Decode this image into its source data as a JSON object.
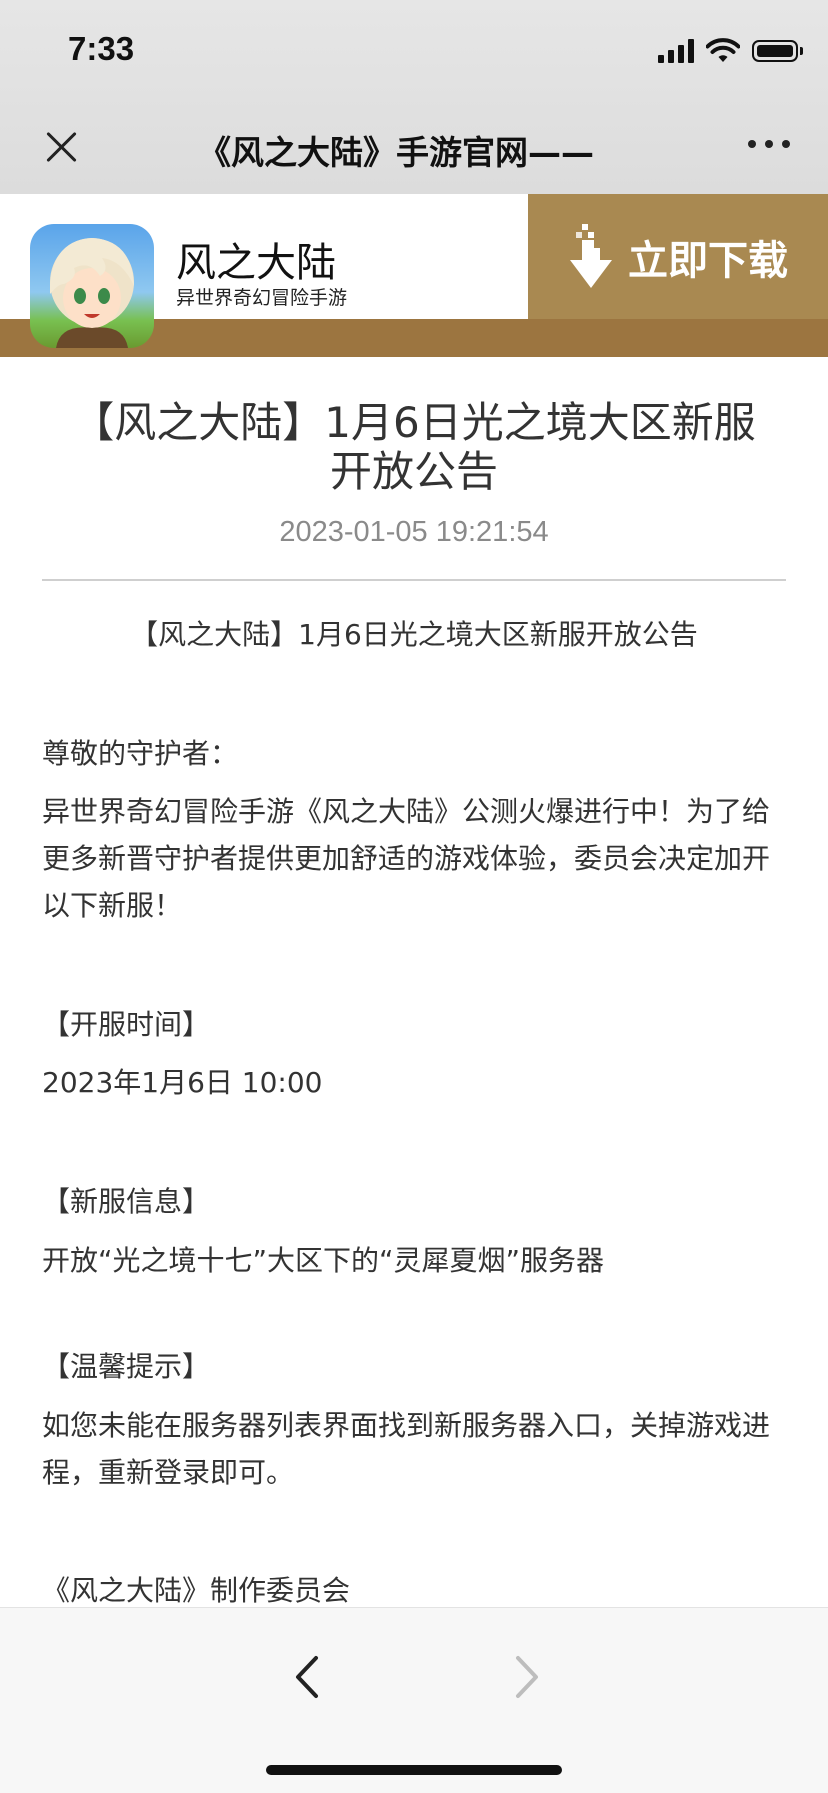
{
  "status_bar": {
    "time": "7:33"
  },
  "title_bar": {
    "title": "《风之大陆》手游官网——"
  },
  "app_banner": {
    "app_name": "风之大陆",
    "app_subtitle": "异世界奇幻冒险手游",
    "download_label": "立即下载",
    "banner_color": "#a98951",
    "strip_color": "#9c7540"
  },
  "article": {
    "title": "【风之大陆】1月6日光之境大区新服开放公告",
    "date": "2023-01-05 19:21:54",
    "heading": "【风之大陆】1月6日光之境大区新服开放公告",
    "greeting": "尊敬的守护者：",
    "intro": "异世界奇幻冒险手游《风之大陆》公测火爆进行中！为了给更多新晋守护者提供更加舒适的游戏体验，委员会决定加开以下新服！",
    "open_time_label": "【开服时间】",
    "open_time": "2023年1月6日 10:00",
    "server_info_label": "【新服信息】",
    "server_info": "开放“光之境十七”大区下的“灵犀夏烟”服务器",
    "tips_label": "【温馨提示】",
    "tips": "如您未能在服务器列表界面找到新服务器入口，关掉游戏进程，重新登录即可。",
    "signature": "《风之大陆》制作委员会"
  },
  "bottom_bar": {
    "back_icon": "chevron-left-icon",
    "forward_icon": "chevron-right-icon"
  }
}
